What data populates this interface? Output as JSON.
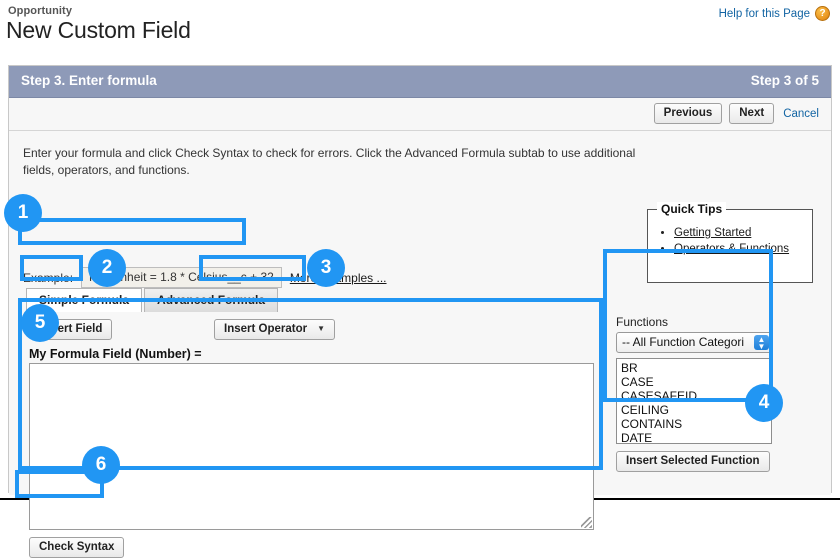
{
  "header": {
    "eyebrow": "Opportunity",
    "title": "New Custom Field",
    "help_link": "Help for this Page",
    "help_icon": "question-mark-icon",
    "help_icon_glyph": "?"
  },
  "step": {
    "title": "Step 3. Enter formula",
    "counter": "Step 3 of 5"
  },
  "toolbar": {
    "previous_label": "Previous",
    "next_label": "Next",
    "cancel_label": "Cancel"
  },
  "instructions": "Enter your formula and click Check Syntax to check for errors. Click the Advanced Formula subtab to use additional fields, operators, and functions.",
  "example": {
    "label": "Example:",
    "value": "Fahrenheit = 1.8 * Celsius__c + 32",
    "more_link": "More Examples ..."
  },
  "tabs": [
    {
      "label": "Simple Formula",
      "active": true
    },
    {
      "label": "Advanced Formula",
      "active": false
    }
  ],
  "quick_tips": {
    "legend": "Quick Tips",
    "links": [
      "Getting Started",
      "Operators & Functions"
    ]
  },
  "editor": {
    "insert_field_label": "Insert Field",
    "insert_operator_label": "Insert Operator",
    "insert_operator_caret": "▼",
    "formula_label": "My Formula Field (Number) =",
    "formula_value": "",
    "check_syntax_label": "Check Syntax"
  },
  "functions": {
    "label": "Functions",
    "category_selected": "-- All Function Categories --",
    "category_display": "-- All Function Categori",
    "items": [
      "BR",
      "CASE",
      "CASESAFEID",
      "CEILING",
      "CONTAINS",
      "DATE"
    ],
    "insert_button_label": "Insert Selected Function"
  },
  "annotations": {
    "accent_color": "#2196f3",
    "badges": [
      "1",
      "2",
      "3",
      "4",
      "5",
      "6"
    ]
  },
  "colors": {
    "step_bar": "#8e9ab8",
    "panel_bg": "#f7f7f7",
    "link": "#1264a3",
    "accent": "#2196f3",
    "help_icon": "#e8931e"
  }
}
